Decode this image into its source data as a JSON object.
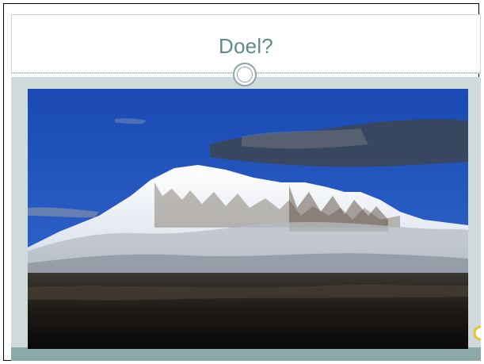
{
  "slide": {
    "title": "Doel?"
  },
  "photo": {
    "icon": "mountain-photo"
  },
  "colors": {
    "title_text": "#5f8a8b",
    "content_background": "#cfdadb",
    "footer_band": "#8ca9aa",
    "sky": "#1f4fb8"
  }
}
